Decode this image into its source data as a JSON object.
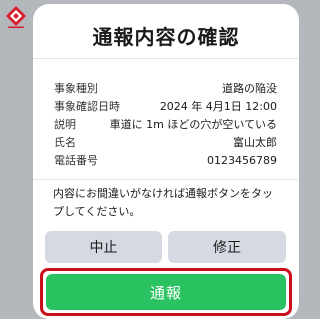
{
  "colors": {
    "overlay": "#b4b7bc",
    "report_button": "#2bc361",
    "secondary_button": "#d5dae2",
    "highlight_border": "#c80f1a",
    "logo": "#d8222b"
  },
  "logo": {
    "icon": "city-emblem-icon"
  },
  "dialog": {
    "title": "通報内容の確認",
    "details": [
      {
        "label": "事象種別",
        "value": "道路の陥没"
      },
      {
        "label": "事象確認日時",
        "value": "2024 年 4月1日 12:00"
      },
      {
        "label": "説明",
        "value": "車道に 1m ほどの穴が空いている"
      },
      {
        "label": "氏名",
        "value": "富山太郎"
      },
      {
        "label": "電話番号",
        "value": "0123456789"
      }
    ],
    "notice": "内容にお間違いがなければ通報ボタンをタップしてください。",
    "buttons": {
      "cancel": "中止",
      "fix": "修正",
      "report": "通報"
    }
  }
}
